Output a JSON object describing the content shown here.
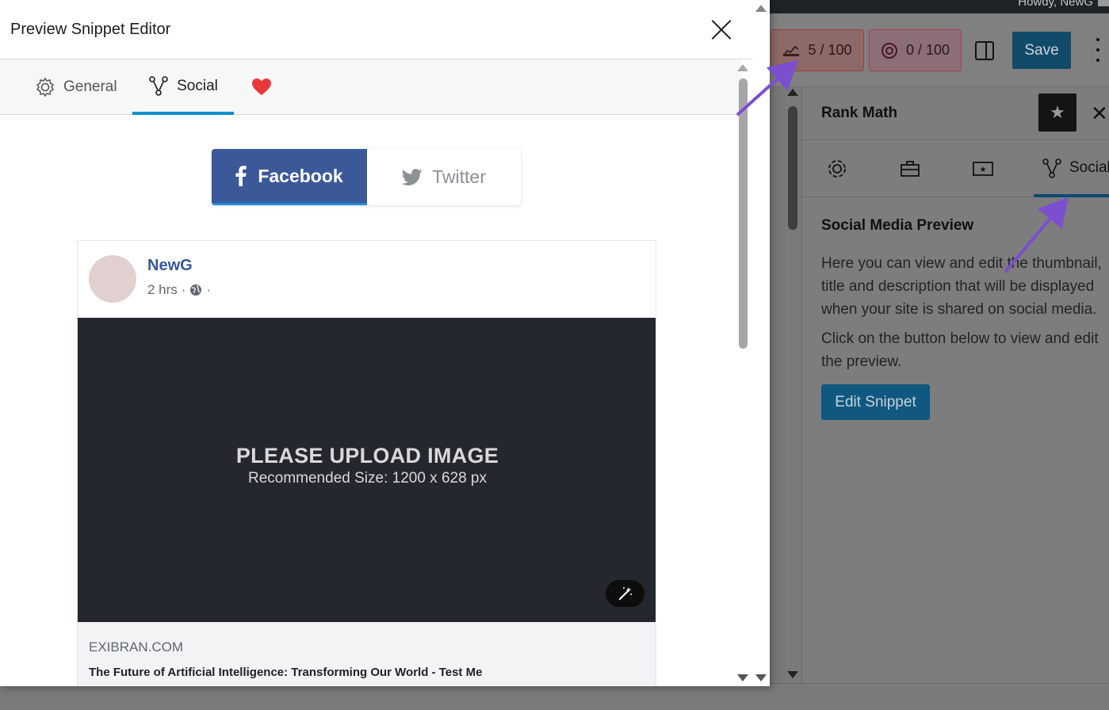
{
  "background": {
    "howdy": "Howdy, NewG",
    "seo_score": "5 / 100",
    "ai_score": "0 / 100",
    "save_label": "Save",
    "sidebar": {
      "title": "Rank Math",
      "active_tab_label": "Social",
      "heading": "Social Media Preview",
      "paragraph1": "Here you can view and edit the thumbnail, title and description that will be displayed when your site is shared on social media.",
      "paragraph2": "Click on the button below to view and edit the preview.",
      "edit_button": "Edit Snippet"
    }
  },
  "modal": {
    "title": "Preview Snippet Editor",
    "tabs": [
      {
        "label": "General",
        "icon": "gear-icon"
      },
      {
        "label": "Social",
        "icon": "share-nodes-icon",
        "active": true
      },
      {
        "label": "",
        "icon": "heart-icon"
      }
    ],
    "networks": {
      "facebook": "Facebook",
      "twitter": "Twitter",
      "active": "facebook"
    },
    "preview": {
      "name": "NewG",
      "time": "2 hrs",
      "upload_title": "PLEASE UPLOAD IMAGE",
      "upload_subtitle": "Recommended Size: 1200 x 628 px",
      "domain": "EXIBRAN.COM",
      "post_title": "The Future of Artificial Intelligence: Transforming Our World - Test Me"
    }
  },
  "colors": {
    "facebook_blue": "#3b5998",
    "tab_accent": "#0a8fd1",
    "heart": "#e8393a",
    "annotation_arrow": "#7b4fd0"
  }
}
